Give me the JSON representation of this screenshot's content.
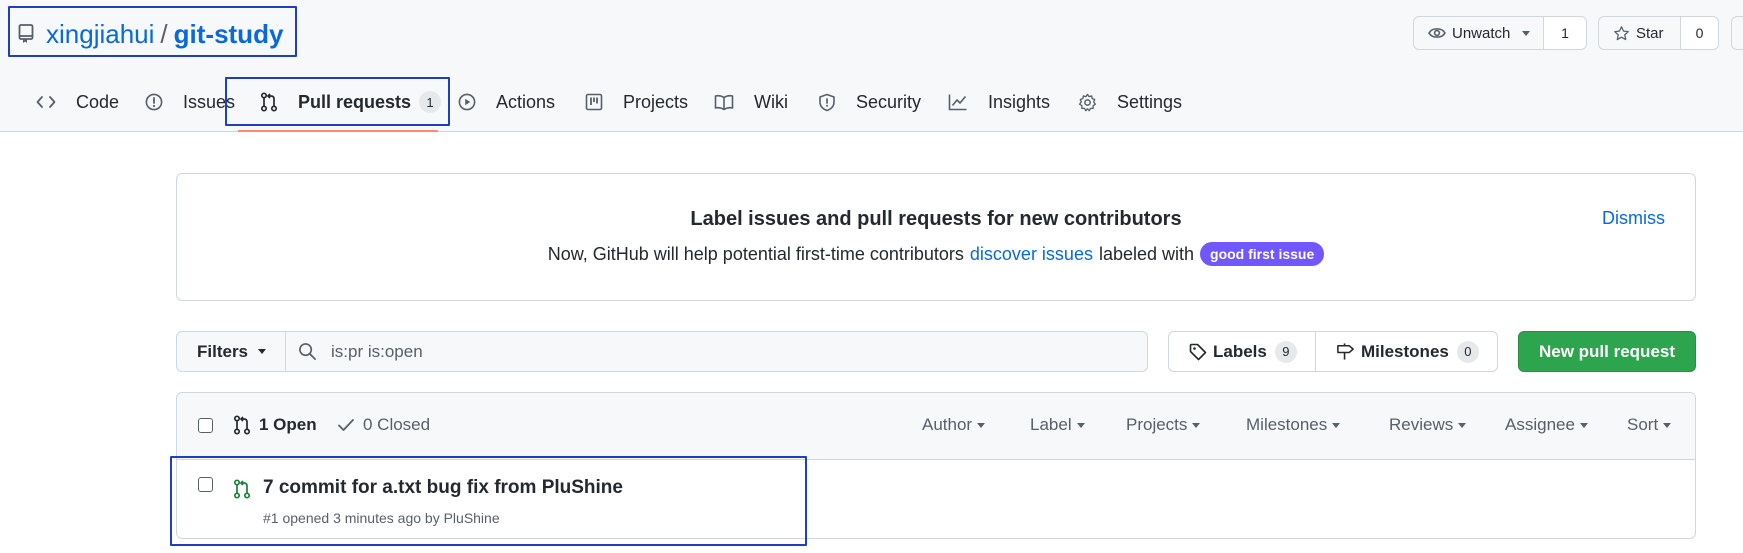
{
  "repo": {
    "owner": "xingjiahui",
    "separator": "/",
    "name": "git-study"
  },
  "header_actions": {
    "unwatch_label": "Unwatch",
    "watch_count": "1",
    "star_label": "Star",
    "star_count": "0"
  },
  "tabs": [
    {
      "label": "Code",
      "icon": "code-icon"
    },
    {
      "label": "Issues",
      "icon": "issue-opened-icon"
    },
    {
      "label": "Pull requests",
      "icon": "git-pull-request-icon",
      "counter": "1",
      "selected": true
    },
    {
      "label": "Actions",
      "icon": "play-icon"
    },
    {
      "label": "Projects",
      "icon": "table-icon"
    },
    {
      "label": "Wiki",
      "icon": "book-icon"
    },
    {
      "label": "Security",
      "icon": "shield-icon"
    },
    {
      "label": "Insights",
      "icon": "graph-icon"
    },
    {
      "label": "Settings",
      "icon": "gear-icon"
    }
  ],
  "banner": {
    "title": "Label issues and pull requests for new contributors",
    "text_before": "Now, GitHub will help potential first-time contributors",
    "link_text": "discover issues",
    "text_after": "labeled with",
    "pill_label": "good first issue",
    "pill_color": "#7057ff",
    "dismiss_label": "Dismiss"
  },
  "filters": {
    "button_label": "Filters",
    "search_value": "is:pr is:open"
  },
  "labels_button": {
    "label": "Labels",
    "count": "9"
  },
  "milestones_button": {
    "label": "Milestones",
    "count": "0"
  },
  "new_pr_button": {
    "label": "New pull request",
    "color": "#2da44e"
  },
  "list_header": {
    "open_label": "1 Open",
    "closed_label": "0 Closed",
    "sort_filters": [
      "Author",
      "Label",
      "Projects",
      "Milestones",
      "Reviews",
      "Assignee",
      "Sort"
    ]
  },
  "pull_requests": [
    {
      "title": "7 commit for a.txt bug fix from PluShine",
      "meta": "#1 opened 3 minutes ago by PluShine"
    }
  ]
}
